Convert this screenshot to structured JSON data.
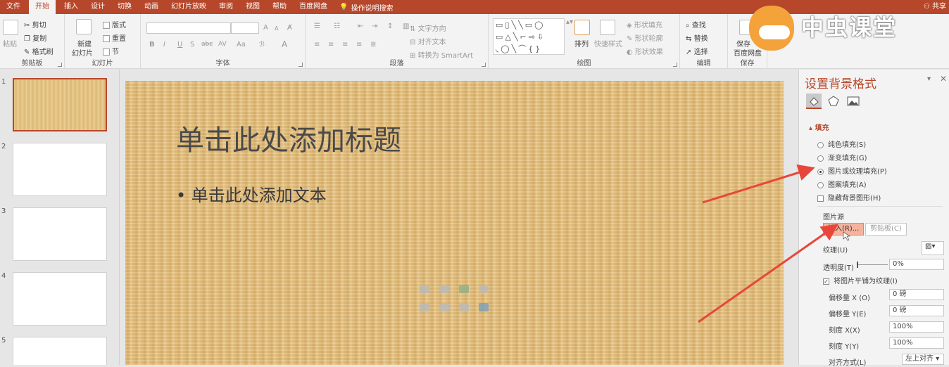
{
  "tabs": [
    "文件",
    "开始",
    "插入",
    "设计",
    "切换",
    "动画",
    "幻灯片放映",
    "审阅",
    "视图",
    "帮助",
    "百度网盘"
  ],
  "active_tab": "开始",
  "tell_me": "操作说明搜索",
  "share": "共享",
  "ribbon": {
    "clipboard": {
      "paste": "粘贴",
      "cut": "剪切",
      "copy": "复制",
      "format_painter": "格式刷",
      "label": "剪贴板"
    },
    "slides": {
      "new_slide_line1": "新建",
      "new_slide_line2": "幻灯片",
      "layout": "版式",
      "reset": "重置",
      "section": "节",
      "label": "幻灯片"
    },
    "font": {
      "bold": "B",
      "italic": "I",
      "underline": "U",
      "strike": "S",
      "abc": "abc",
      "spacing": "AV",
      "case": "Aa",
      "grow": "A",
      "shrink": "A",
      "label": "字体"
    },
    "paragraph": {
      "text_direction": "文字方向",
      "align_text": "对齐文本",
      "smartart": "转换为 SmartArt",
      "label": "段落"
    },
    "drawing": {
      "arrange": "排列",
      "quick_styles": "快速样式",
      "shape_fill": "形状填充",
      "shape_outline": "形状轮廓",
      "shape_effects": "形状效果",
      "label": "绘图"
    },
    "editing": {
      "find": "查找",
      "replace": "替换",
      "select": "选择",
      "label": "编辑"
    },
    "save": {
      "line1": "保存",
      "line2": "百度网盘",
      "label": "保存"
    }
  },
  "logo": {
    "text": "中虫课堂"
  },
  "thumbnails": [
    {
      "num": "1"
    },
    {
      "num": "2"
    },
    {
      "num": "3"
    },
    {
      "num": "4"
    },
    {
      "num": "5"
    }
  ],
  "slide": {
    "title": "单击此处添加标题",
    "body": "• 单击此处添加文本"
  },
  "pane": {
    "title": "设置背景格式",
    "section": "填充",
    "options": [
      "纯色填充(S)",
      "渐变填充(G)",
      "图片或纹理填充(P)",
      "图案填充(A)"
    ],
    "selected_option": "图片或纹理填充(P)",
    "hide_bg": "隐藏背景图形(H)",
    "picture_source": "图片源",
    "insert": "插入(R)...",
    "clipboard": "剪贴板(C)",
    "texture": "纹理(U)",
    "transparency": "透明度(T)",
    "transparency_value": "0%",
    "tile": "将图片平铺为纹理(I)",
    "tile_checked": true,
    "offset_x": "偏移量 X (O)",
    "offset_x_value": "0 磅",
    "offset_y": "偏移量 Y(E)",
    "offset_y_value": "0 磅",
    "scale_x": "刻度 X(X)",
    "scale_x_value": "100%",
    "scale_y": "刻度 Y(Y)",
    "scale_y_value": "100%",
    "align": "对齐方式(L)",
    "align_value": "左上对齐"
  },
  "colors": {
    "accent": "#b7472a",
    "arrow": "#e8463a",
    "highlight": "#f4b39d"
  }
}
